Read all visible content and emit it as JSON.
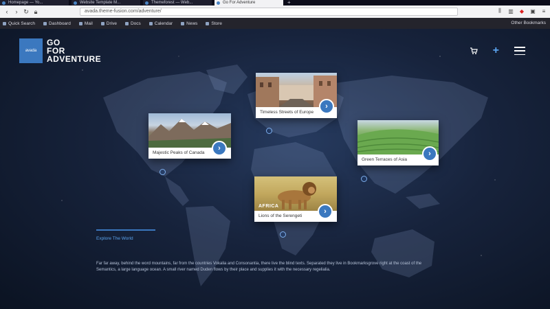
{
  "browser": {
    "tabs": [
      {
        "label": "Homepage — Yo...",
        "active": false
      },
      {
        "label": "Website Template M...",
        "active": false
      },
      {
        "label": "Themeforest — Web...",
        "active": false
      },
      {
        "label": "Go For Adventure",
        "active": true
      }
    ],
    "url": "avada.theme-fusion.com/adventure/",
    "bookmarks": [
      "Quick Search",
      "Dashboard",
      "Mail",
      "Drive",
      "Docs",
      "Calendar",
      "News",
      "Store"
    ],
    "bookmarks_right": "Other Bookmarks"
  },
  "site": {
    "logo_badge": "avada",
    "logo_lines": [
      "GO",
      "FOR",
      "ADVENTURE"
    ],
    "accent_color": "#3b78bf",
    "icons": [
      "cart-icon",
      "plus-icon",
      "menu-icon"
    ]
  },
  "cards": [
    {
      "id": "north-america",
      "caption": "Majestic Peaks of Canada",
      "label": "",
      "image": "mountain-lake"
    },
    {
      "id": "europe",
      "caption": "Timeless Streets of Europe",
      "label": "",
      "image": "old-town-street"
    },
    {
      "id": "asia",
      "caption": "Green Terraces of Asia",
      "label": "",
      "image": "rice-terraces"
    },
    {
      "id": "africa",
      "caption": "Lions of the Serengeti",
      "label": "AFRICA",
      "image": "lion-savanna"
    }
  ],
  "explore": {
    "label": "Explore The World"
  },
  "body_text": "Far far away, behind the word mountains, far from the countries Vokalia and Consonantia, there live the blind texts. Separated they live in Bookmarksgrove right at the coast of the Semantics, a large language ocean. A small river named Duden flows by their place and supplies it with the necessary regelialia."
}
